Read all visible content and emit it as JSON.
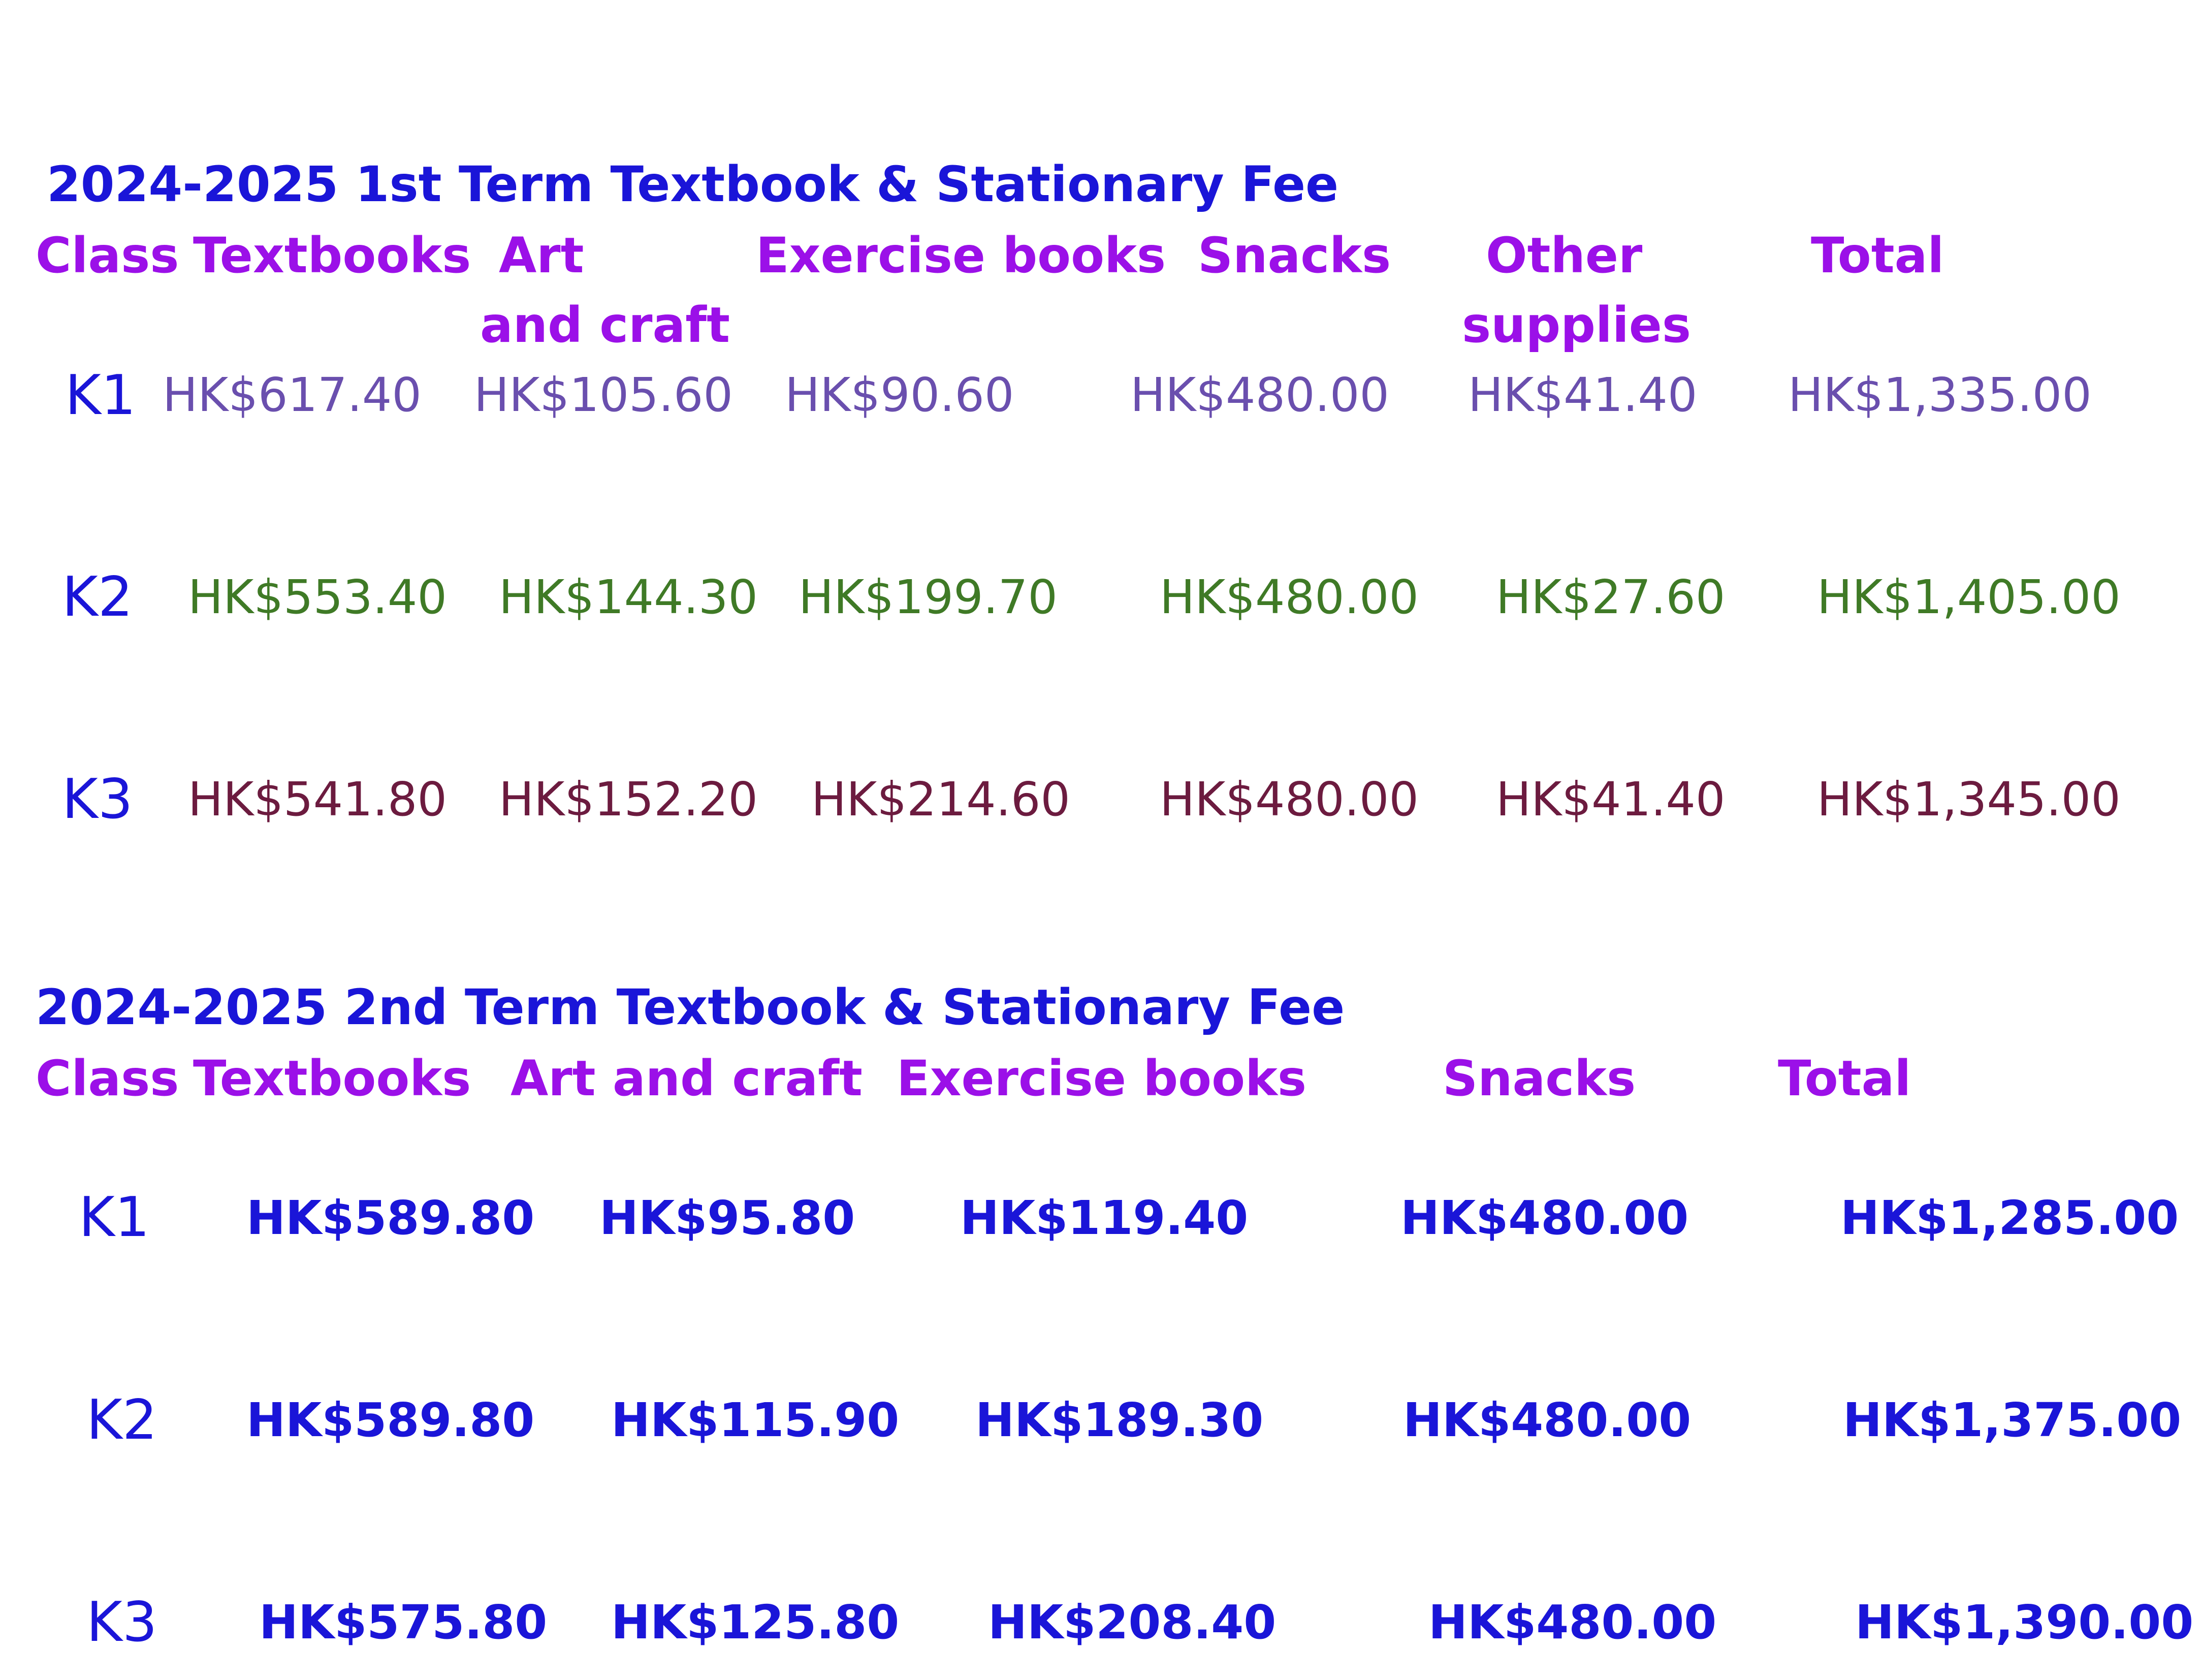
{
  "colors": {
    "title": "#1a15d8",
    "header": "#9b10e8",
    "class_label": "#1a15d8",
    "k1_term1": "#6a4fae",
    "k2_term1": "#3f7a26",
    "k3_term1": "#6c1b3f",
    "term2_values": "#1a15d8"
  },
  "term1": {
    "title": "2024-2025 1st Term Textbook & Stationary Fee",
    "headers": {
      "class": "Class",
      "textbooks": "Textbooks",
      "art_1": "Art",
      "art_2": "and craft",
      "exercise": "Exercise books",
      "snacks": "Snacks",
      "other_1": "Other",
      "other_2": "supplies",
      "total": "Total"
    },
    "rows": [
      {
        "class": "K1",
        "textbooks": "HK$617.40",
        "art": "HK$105.60",
        "exercise": "HK$90.60",
        "snacks": "HK$480.00",
        "other": "HK$41.40",
        "total": "HK$1,335.00"
      },
      {
        "class": "K2",
        "textbooks": "HK$553.40",
        "art": "HK$144.30",
        "exercise": "HK$199.70",
        "snacks": "HK$480.00",
        "other": "HK$27.60",
        "total": "HK$1,405.00"
      },
      {
        "class": "K3",
        "textbooks": "HK$541.80",
        "art": "HK$152.20",
        "exercise": "HK$214.60",
        "snacks": "HK$480.00",
        "other": "HK$41.40",
        "total": "HK$1,345.00"
      }
    ]
  },
  "term2": {
    "title": "2024-2025 2nd Term Textbook & Stationary Fee",
    "headers": {
      "class": "Class",
      "textbooks": "Textbooks",
      "art": "Art and craft",
      "exercise": "Exercise books",
      "snacks": "Snacks",
      "total": "Total"
    },
    "rows": [
      {
        "class": "K1",
        "textbooks": "HK$589.80",
        "art": "HK$95.80",
        "exercise": "HK$119.40",
        "snacks": "HK$480.00",
        "total": "HK$1,285.00"
      },
      {
        "class": "K2",
        "textbooks": "HK$589.80",
        "art": "HK$115.90",
        "exercise": "HK$189.30",
        "snacks": "HK$480.00",
        "total": "HK$1,375.00"
      },
      {
        "class": "K3",
        "textbooks": "HK$575.80",
        "art": "HK$125.80",
        "exercise": "HK$208.40",
        "snacks": "HK$480.00",
        "total": "HK$1,390.00"
      }
    ]
  }
}
